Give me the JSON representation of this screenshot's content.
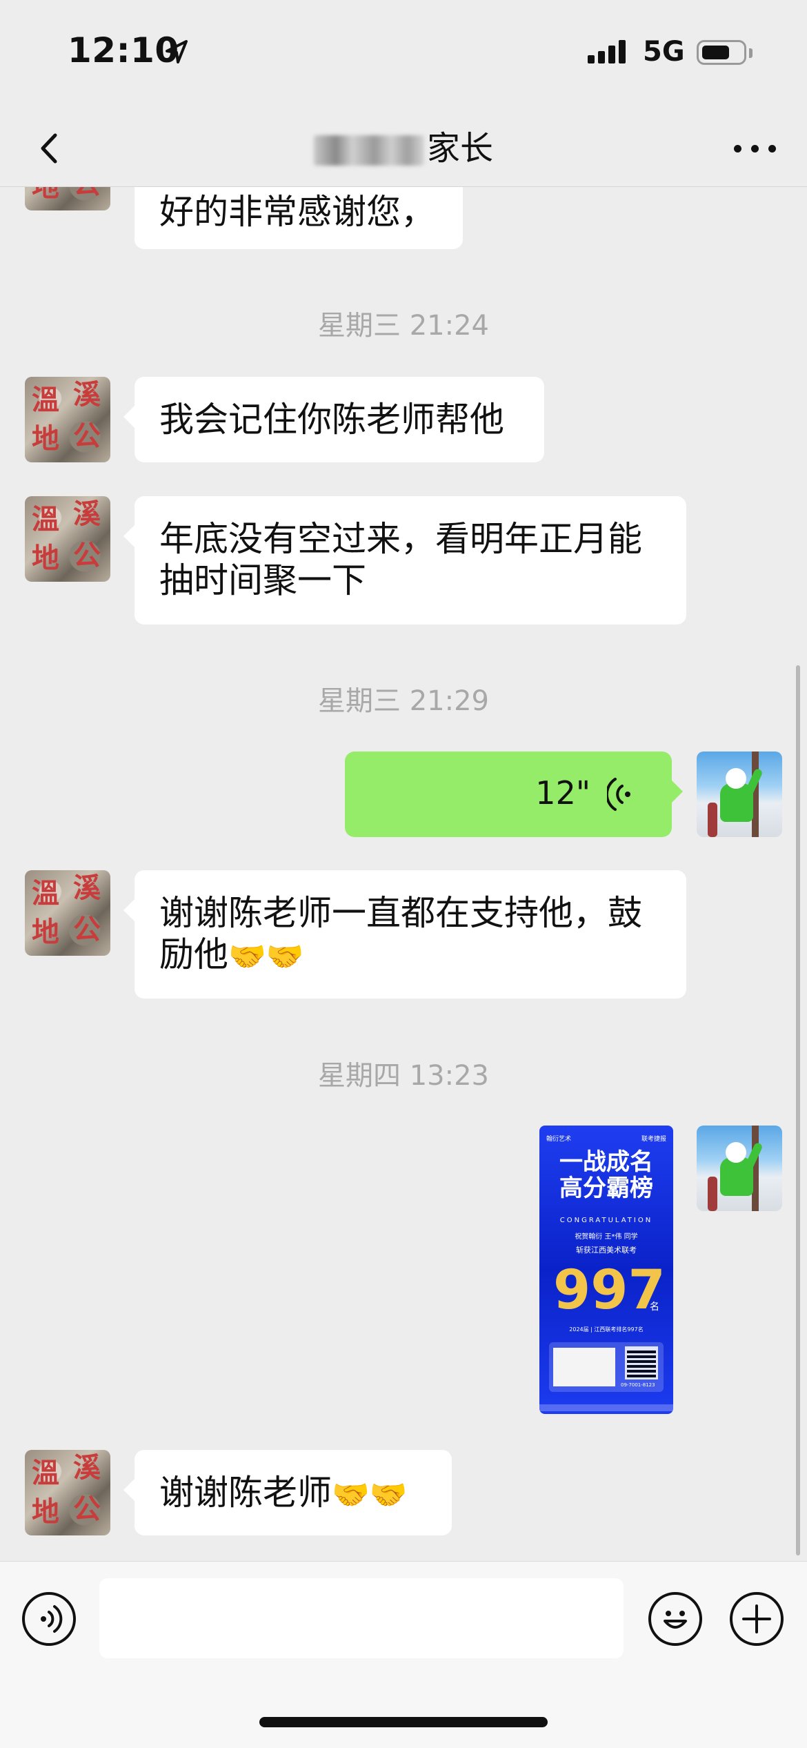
{
  "status_bar": {
    "time": "12:10",
    "network": "5G",
    "battery_level": 0.7
  },
  "nav": {
    "title": "家长"
  },
  "messages": [
    {
      "text": "好的非常感谢您，"
    },
    {
      "time": "星期三 21:24"
    },
    {
      "text": "我会记住你陈老师帮他"
    },
    {
      "text_line1": "年底没有空过来，看明年正月能",
      "text_line2": "抽时间聚一下"
    },
    {
      "time": "星期三 21:29"
    },
    {
      "voice_duration": "12\""
    },
    {
      "text_line1": "谢谢陈老师一直都在支持他，鼓",
      "text_line2": "励他",
      "emoji": "🤝🤝"
    },
    {
      "time": "星期四 13:23"
    },
    {
      "image": {
        "top_label": "翰衍艺术",
        "top_right": "联考捷报",
        "title_line1": "一战成名",
        "title_line2": "高分霸榜",
        "congrats": "CONGRATULATION",
        "line1": "祝贺翰衍    王*伟    同学",
        "line2": "斩获江西美术联考",
        "score": "997",
        "unit": "名",
        "caption": "2024届 | 江西联考排名997名",
        "phone": "09-7001-8123"
      }
    },
    {
      "text": "谢谢陈老师",
      "emoji": "🤝🤝"
    }
  ],
  "avatar_chars": [
    "溫",
    "地",
    "公",
    "溪"
  ],
  "colors": {
    "accent": "#95ec69",
    "background": "#ededed",
    "timestamp": "#a8a8a8"
  },
  "icons": {
    "back": "chevron-left-icon",
    "more": "more-dots-icon",
    "voice": "voice-wave-icon",
    "emoji": "smile-icon",
    "plus": "plus-icon",
    "location": "location-arrow-icon"
  }
}
